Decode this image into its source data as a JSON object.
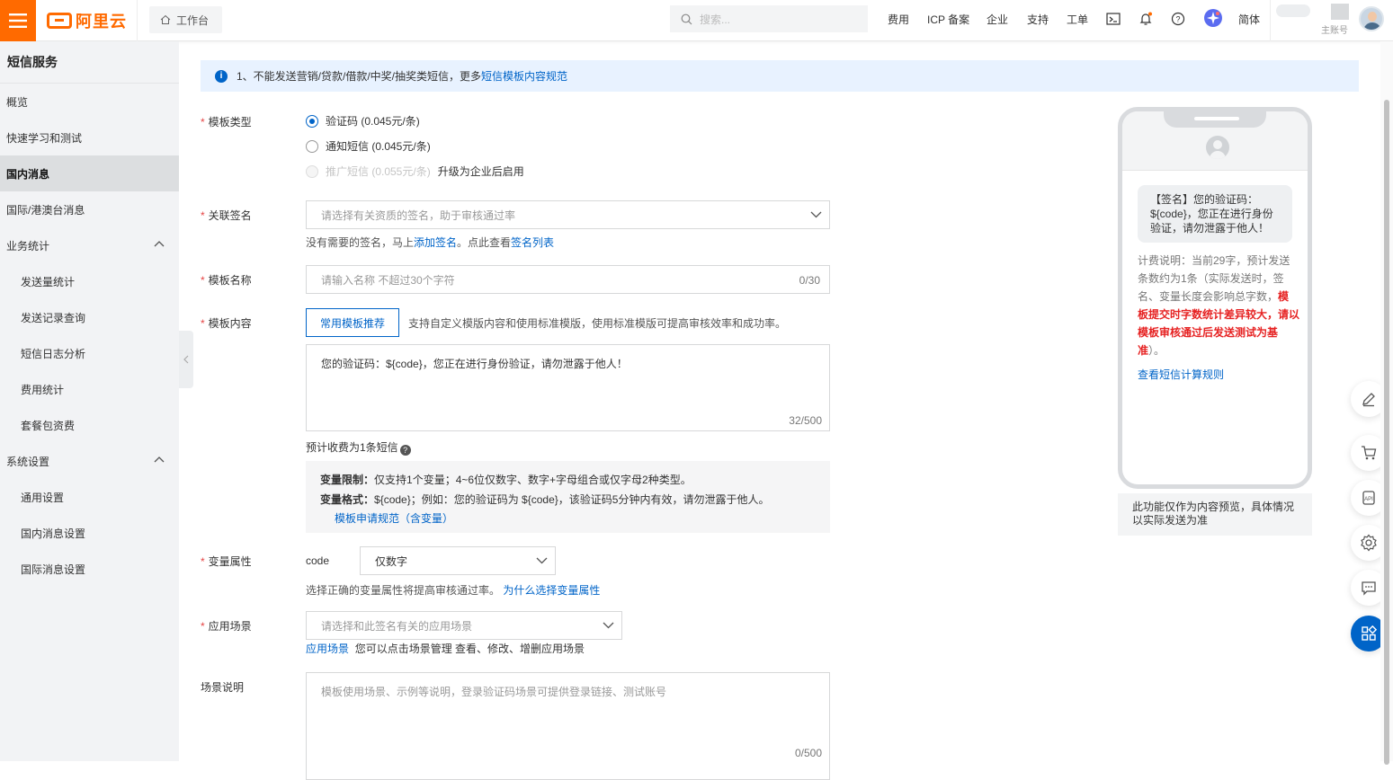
{
  "header": {
    "brand": "阿里云",
    "workbench": "工作台",
    "search_placeholder": "搜索...",
    "nav": [
      "费用",
      "ICP 备案",
      "企业",
      "支持",
      "工单"
    ],
    "lang": "简体",
    "account_label": "主账号"
  },
  "sidebar": {
    "title": "短信服务",
    "items": [
      {
        "label": "概览",
        "sub": false
      },
      {
        "label": "快速学习和测试",
        "sub": false
      },
      {
        "label": "国内消息",
        "sub": false,
        "active": true
      },
      {
        "label": "国际/港澳台消息",
        "sub": false
      },
      {
        "label": "业务统计",
        "sub": false,
        "group": true
      },
      {
        "label": "发送量统计",
        "sub": true
      },
      {
        "label": "发送记录查询",
        "sub": true
      },
      {
        "label": "短信日志分析",
        "sub": true
      },
      {
        "label": "费用统计",
        "sub": true
      },
      {
        "label": "套餐包资费",
        "sub": true
      },
      {
        "label": "系统设置",
        "sub": false,
        "group": true
      },
      {
        "label": "通用设置",
        "sub": true
      },
      {
        "label": "国内消息设置",
        "sub": true
      },
      {
        "label": "国际消息设置",
        "sub": true
      }
    ]
  },
  "notice": {
    "text": "1、不能发送营销/贷款/借款/中奖/抽奖类短信，更多",
    "link": "短信模板内容规范"
  },
  "form": {
    "template_type": {
      "label": "模板类型",
      "options": [
        {
          "label": "验证码 (0.045元/条)",
          "state": "checked"
        },
        {
          "label": "通知短信 (0.045元/条)",
          "state": "unchecked"
        },
        {
          "label": "推广短信 (0.055元/条)",
          "state": "disabled",
          "extra": "升级为企业后启用"
        }
      ]
    },
    "signature": {
      "label": "关联签名",
      "placeholder": "请选择有关资质的签名，助于审核通过率",
      "hint_prefix": "没有需要的签名，马上",
      "hint_link1": "添加签名",
      "hint_mid": "。点此查看",
      "hint_link2": "签名列表"
    },
    "name": {
      "label": "模板名称",
      "placeholder": "请输入名称 不超过30个字符",
      "count": "0/30"
    },
    "content": {
      "label": "模板内容",
      "recommend_button": "常用模板推荐",
      "recommend_hint": "支持自定义模版内容和使用标准模版，使用标准模版可提高审核效率和成功率。",
      "value": "您的验证码：${code}，您正在进行身份验证，请勿泄露于他人！",
      "count": "32/500",
      "estimate": "预计收费为1条短信",
      "var_limit_title": "变量限制：",
      "var_limit_text": "仅支持1个变量；4~6位仅数字、数字+字母组合或仅字母2种类型。",
      "var_format_title": "变量格式：",
      "var_format_text": "${code}；例如：您的验证码为 ${code}，该验证码5分钟内有效，请勿泄露于他人。",
      "rule_link": "模板申请规范（含变量）"
    },
    "variable": {
      "label": "变量属性",
      "name": "code",
      "value": "仅数字",
      "hint": "选择正确的变量属性将提高审核通过率。",
      "hint_link": "为什么选择变量属性"
    },
    "scene": {
      "label": "应用场景",
      "placeholder": "请选择和此签名有关的应用场景",
      "hint_link": "应用场景",
      "hint": "您可以点击场景管理 查看、修改、增删应用场景"
    },
    "scene_desc": {
      "label": "场景说明",
      "placeholder": "模板使用场景、示例等说明，登录验证码场景可提供登录链接、测试账号",
      "count": "0/500"
    }
  },
  "preview": {
    "bubble": "【签名】您的验证码：${code}，您正在进行身份验证，请勿泄露于他人！",
    "billing_prefix": "计费说明：当前29字，预计发送条数约为1条（实际发送时，签名、变量长度会影响总字数，",
    "billing_red": "模板提交时字数统计差异较大，请以模板审核通过后发送测试为基准",
    "billing_suffix": "）。",
    "billing_link": "查看短信计算规则",
    "note": "此功能仅作为内容预览，具体情况以实际发送为准"
  },
  "colors": {
    "brand": "#ff6a00",
    "primary": "#0064c8",
    "warning": "#e62222"
  }
}
